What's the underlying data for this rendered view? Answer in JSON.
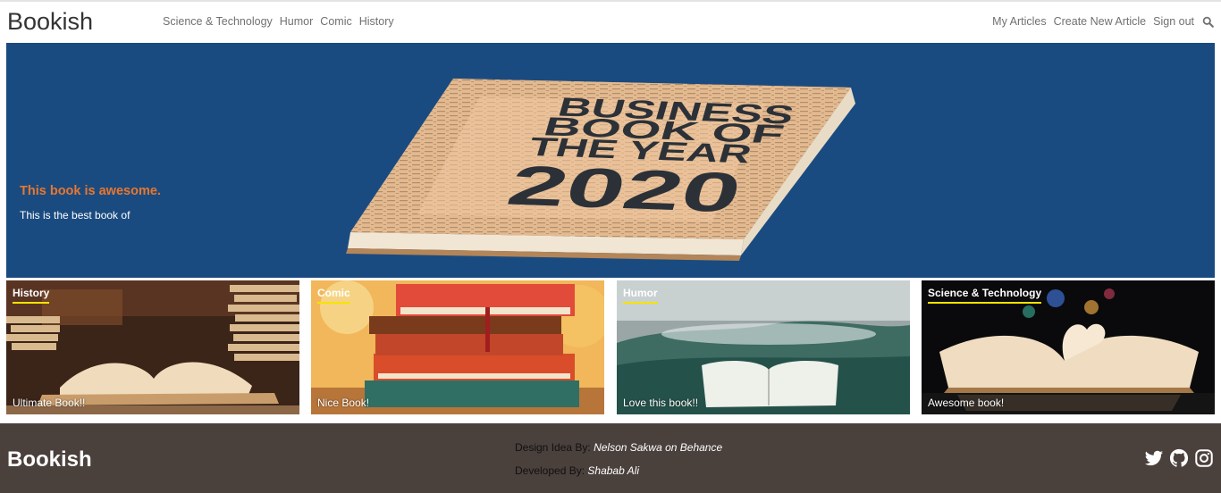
{
  "navbar": {
    "brand": "Bookish",
    "categories": [
      "Science & Technology",
      "Humor",
      "Comic",
      "History"
    ],
    "right_links": [
      "My Articles",
      "Create New Article",
      "Sign out"
    ],
    "search_icon": "search-icon"
  },
  "hero": {
    "title": "This book is awesome.",
    "text": "This is the best book of",
    "book_cover_lines": [
      "BUSINESS",
      "BOOK OF",
      "THE YEAR",
      "2020"
    ],
    "background_color": "#1a4b80",
    "title_color": "#e8772e"
  },
  "cards": [
    {
      "category": "History",
      "text": "Ultimate Book!!"
    },
    {
      "category": "Comic",
      "text": "Nice Book!"
    },
    {
      "category": "Humor",
      "text": "Love this book!!"
    },
    {
      "category": "Science & Technology",
      "text": "Awesome book!"
    }
  ],
  "footer": {
    "brand": "Bookish",
    "design_label": "Design Idea By:",
    "design_name": "Nelson Sakwa on Behance",
    "developer_label": "Developed By:",
    "developer_name": "Shabab Ali",
    "social_icons": [
      "twitter-icon",
      "github-icon",
      "instagram-icon"
    ],
    "background_color": "#4a403c"
  },
  "accent_underline_color": "#f5e400"
}
